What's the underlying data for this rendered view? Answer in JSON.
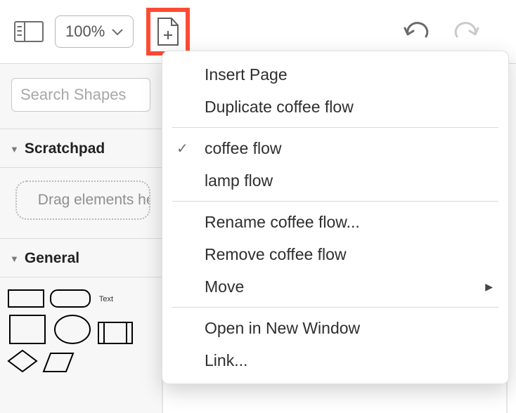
{
  "toolbar": {
    "zoom_value": "100%"
  },
  "sidebar": {
    "search_placeholder": "Search Shapes",
    "scratchpad": {
      "title": "Scratchpad",
      "hint": "Drag elements here"
    },
    "general": {
      "title": "General",
      "text_shape_label": "Text"
    }
  },
  "page_menu": {
    "items": [
      {
        "label": "Insert Page",
        "checked": false,
        "submenu": false
      },
      {
        "label": "Duplicate coffee flow",
        "checked": false,
        "submenu": false
      },
      null,
      {
        "label": "coffee flow",
        "checked": true,
        "submenu": false
      },
      {
        "label": "lamp flow",
        "checked": false,
        "submenu": false
      },
      null,
      {
        "label": "Rename coffee flow...",
        "checked": false,
        "submenu": false
      },
      {
        "label": "Remove coffee flow",
        "checked": false,
        "submenu": false
      },
      {
        "label": "Move",
        "checked": false,
        "submenu": true
      },
      null,
      {
        "label": "Open in New Window",
        "checked": false,
        "submenu": false
      },
      {
        "label": "Link...",
        "checked": false,
        "submenu": false
      }
    ]
  }
}
